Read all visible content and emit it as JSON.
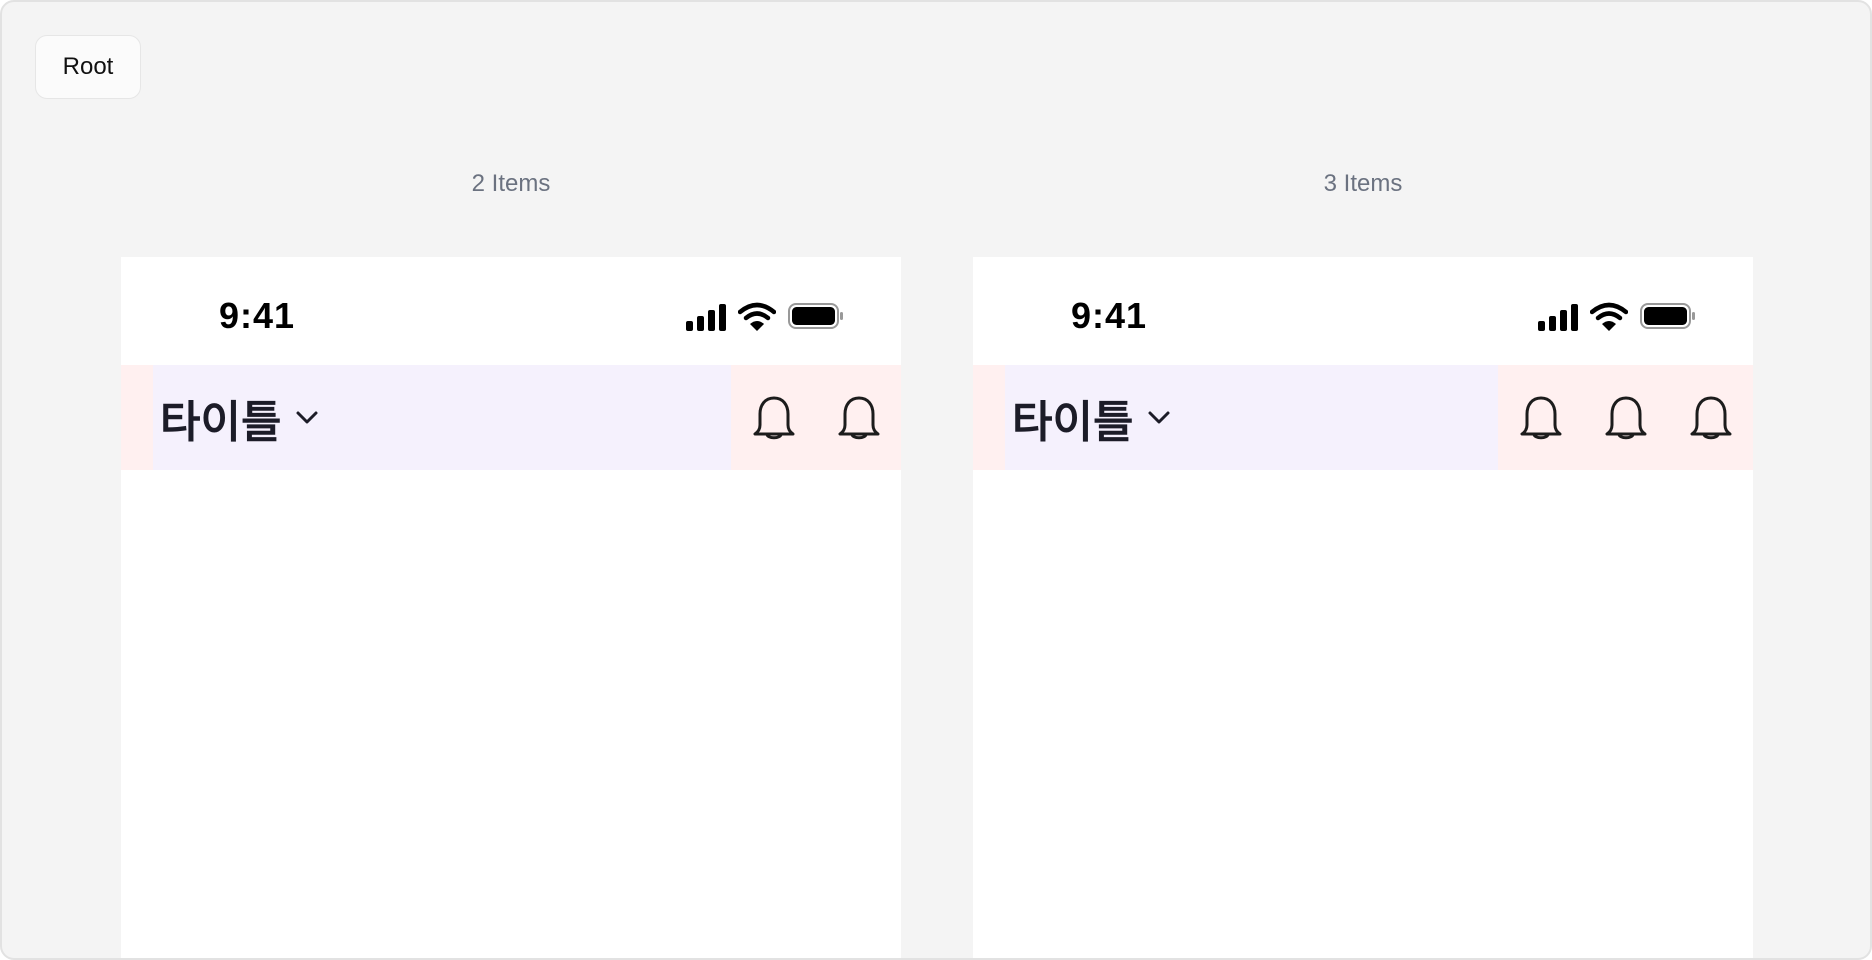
{
  "root_chip": {
    "label": "Root"
  },
  "groups": [
    {
      "label": "2 Items",
      "status": {
        "time": "9:41"
      },
      "nav": {
        "title": "타이틀",
        "dropdown_icon": "chevron-down-icon",
        "actions": [
          "bell-icon",
          "bell-icon"
        ]
      }
    },
    {
      "label": "3 Items",
      "status": {
        "time": "9:41"
      },
      "nav": {
        "title": "타이틀",
        "dropdown_icon": "chevron-down-icon",
        "actions": [
          "bell-icon",
          "bell-icon",
          "bell-icon"
        ]
      }
    }
  ],
  "colors": {
    "canvas_bg": "#f4f4f4",
    "phone_bg": "#ffffff",
    "nav_title_bg": "#f5f1fd",
    "nav_side_bg": "#fff0f0",
    "icon_color": "#1c1c1c",
    "label_color": "#6b7280"
  }
}
